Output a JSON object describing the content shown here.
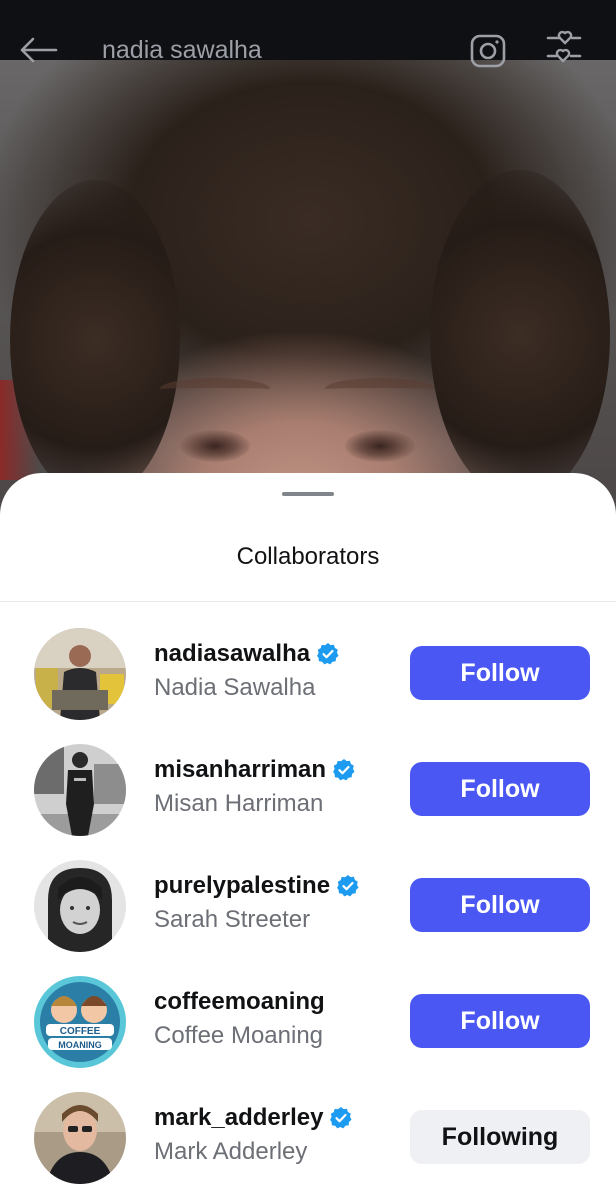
{
  "header": {
    "title": "nadia sawalha",
    "back_icon": "arrow-left-icon",
    "camera_icon": "camera-icon",
    "filter_icon": "filter-heart-icon"
  },
  "sheet": {
    "title": "Collaborators"
  },
  "collaborators": [
    {
      "username": "nadiasawalha",
      "full_name": "Nadia Sawalha",
      "verified": true,
      "button": "Follow",
      "state": "follow"
    },
    {
      "username": "misanharriman",
      "full_name": "Misan Harriman",
      "verified": true,
      "button": "Follow",
      "state": "follow"
    },
    {
      "username": "purelypalestine",
      "full_name": "Sarah Streeter",
      "verified": true,
      "button": "Follow",
      "state": "follow"
    },
    {
      "username": "coffeemoaning",
      "full_name": "Coffee Moaning",
      "verified": false,
      "button": "Follow",
      "state": "follow"
    },
    {
      "username": "mark_adderley",
      "full_name": "Mark Adderley",
      "verified": true,
      "button": "Following",
      "state": "following"
    }
  ],
  "colors": {
    "follow_button": "#4a57f3",
    "following_button": "#eff0f3",
    "verified_badge": "#1d9bf0"
  }
}
